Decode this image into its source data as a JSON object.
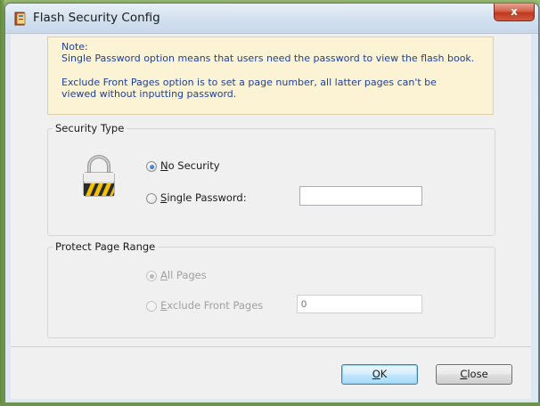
{
  "window": {
    "title": "Flash Security Config",
    "close_glyph": "x"
  },
  "note": {
    "lines": [
      "Note:",
      "Single Password option means that users need the password to view the flash book.",
      "",
      "Exclude Front Pages option is to set a page number, all latter pages can't be",
      "viewed without inputting password."
    ]
  },
  "security": {
    "legend": "Security Type",
    "icon": "padlock-icon",
    "options": [
      {
        "prefix": "",
        "accel": "N",
        "rest": "o Security",
        "selected": true
      },
      {
        "prefix": "",
        "accel": "S",
        "rest": "ingle Password:",
        "selected": false
      }
    ],
    "password_value": ""
  },
  "range": {
    "legend": "Protect Page Range",
    "options": [
      {
        "prefix": "",
        "accel": "A",
        "rest": "ll Pages",
        "selected": true,
        "enabled": false
      },
      {
        "prefix": "",
        "accel": "E",
        "rest": "xclude Front Pages",
        "selected": false,
        "enabled": false
      }
    ],
    "front_pages_value": "0"
  },
  "buttons": {
    "ok": {
      "prefix": "",
      "accel": "O",
      "rest": "K"
    },
    "close": {
      "prefix": "",
      "accel": "C",
      "rest": "lose"
    }
  },
  "colors": {
    "note_text": "#1c3f9c",
    "note_bg": "#fbf3d4",
    "accent_radio": "#1e5fb8",
    "close_button": "#c0391f"
  }
}
